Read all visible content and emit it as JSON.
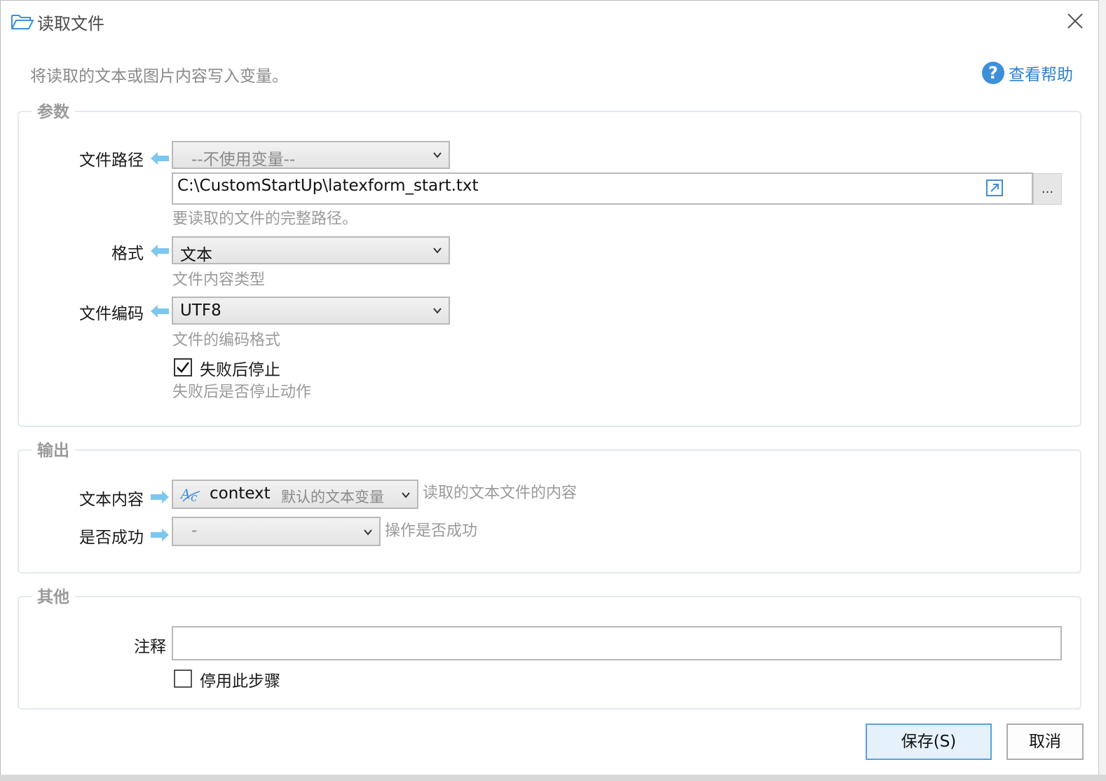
{
  "window": {
    "title": "读取文件",
    "icon": "folder-open-icon"
  },
  "description": "将读取的文本或图片内容写入变量。",
  "help": {
    "label": "查看帮助",
    "icon": "question-circle-icon"
  },
  "params": {
    "section_title": "参数",
    "file_path": {
      "label": "文件路径",
      "variable_select": "--不使用变量--",
      "value": "C:\\CustomStartUp\\latexform_start.txt",
      "browse_label": "...",
      "hint": "要读取的文件的完整路径。"
    },
    "format": {
      "label": "格式",
      "value": "文本",
      "hint": "文件内容类型"
    },
    "encoding": {
      "label": "文件编码",
      "value": "UTF8",
      "hint": "文件的编码格式"
    },
    "stop_on_fail": {
      "label": "失败后停止",
      "checked": true,
      "hint": "失败后是否停止动作"
    }
  },
  "output": {
    "section_title": "输出",
    "text_content": {
      "label": "文本内容",
      "var_name": "context",
      "var_desc": "默认的文本变量",
      "hint": "读取的文本文件的内容"
    },
    "success": {
      "label": "是否成功",
      "value": "-",
      "hint": "操作是否成功"
    }
  },
  "other": {
    "section_title": "其他",
    "comment": {
      "label": "注释",
      "value": ""
    },
    "disable_step": {
      "label": "停用此步骤",
      "checked": false
    }
  },
  "buttons": {
    "save": "保存(S)",
    "cancel": "取消"
  },
  "colors": {
    "accent": "#3d8fd9",
    "arrow": "#7cc7ef",
    "border": "#e3e9ef"
  }
}
